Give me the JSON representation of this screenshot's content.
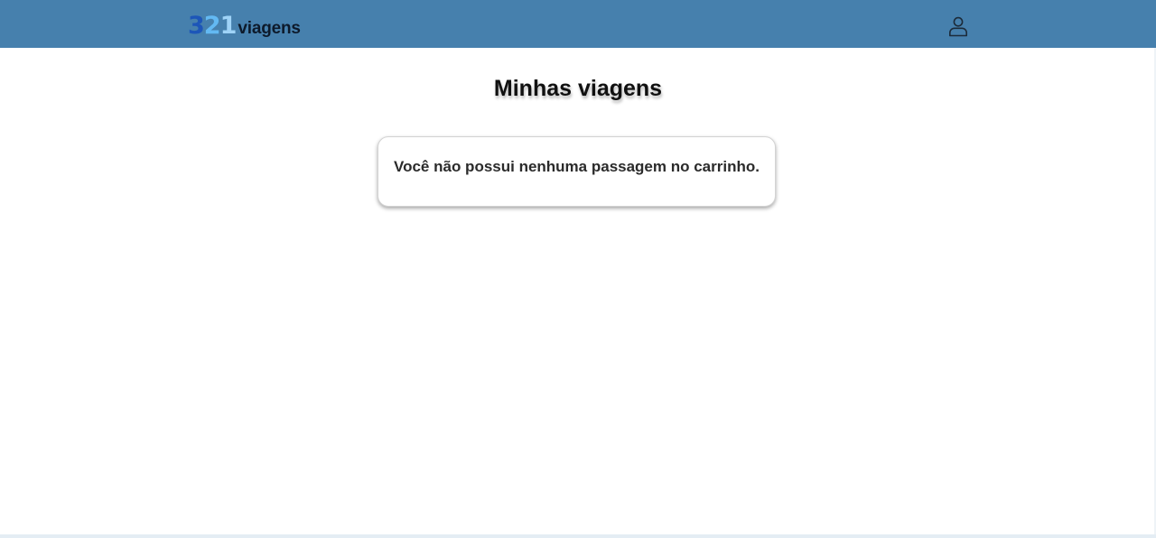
{
  "header": {
    "logo": {
      "digit_3": "3",
      "digit_2": "2",
      "digit_1": "1",
      "word": "viagens"
    },
    "user_icon": "user-icon",
    "background_color": "#4680ad"
  },
  "main": {
    "title": "Minhas viagens",
    "empty_message": "Você não possui nenhuma passagem no carrinho."
  }
}
